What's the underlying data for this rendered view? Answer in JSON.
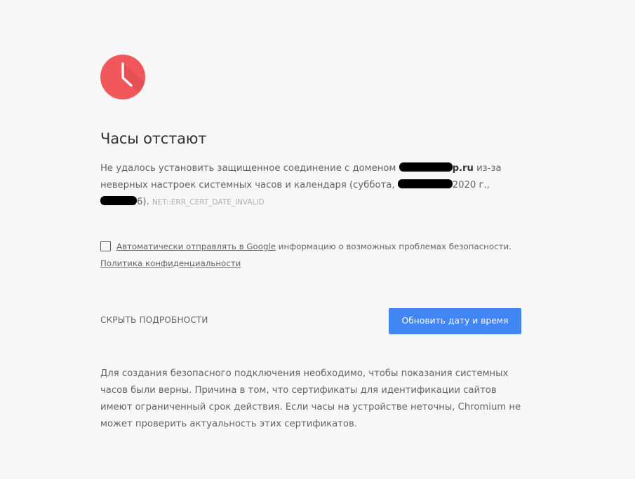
{
  "icon": {
    "name": "clock-icon",
    "color": "#f2585b",
    "shadow": "#d94a4d"
  },
  "heading": "Часы отстают",
  "main_message": {
    "prefix": "Не удалось установить защищенное соединение с доменом ",
    "domain_suffix": "p.ru",
    "middle": " из-за неверных настроек системных часов и календаря (суббота, ",
    "year": "2020 г.,",
    "time_suffix": "6).",
    "error_code": "NET::ERR_CERT_DATE_INVALID"
  },
  "reporting": {
    "link_label": "Автоматически отправлять в Google",
    "rest": " информацию о возможных проблемах безопасности.",
    "privacy_link": "Политика конфиденциальности",
    "checked": false
  },
  "details_button": "СКРЫТЬ ПОДРОБНОСТИ",
  "primary_button": "Обновить дату и время",
  "primary_color": "#4285f4",
  "details_text": "Для создания безопасного подключения необходимо, чтобы показания системных часов были верны. Причина в том, что сертификаты для идентификации сайтов имеют ограниченный срок действия. Если часы на устройстве неточны, Chromium не может проверить актуальность этих сертификатов."
}
